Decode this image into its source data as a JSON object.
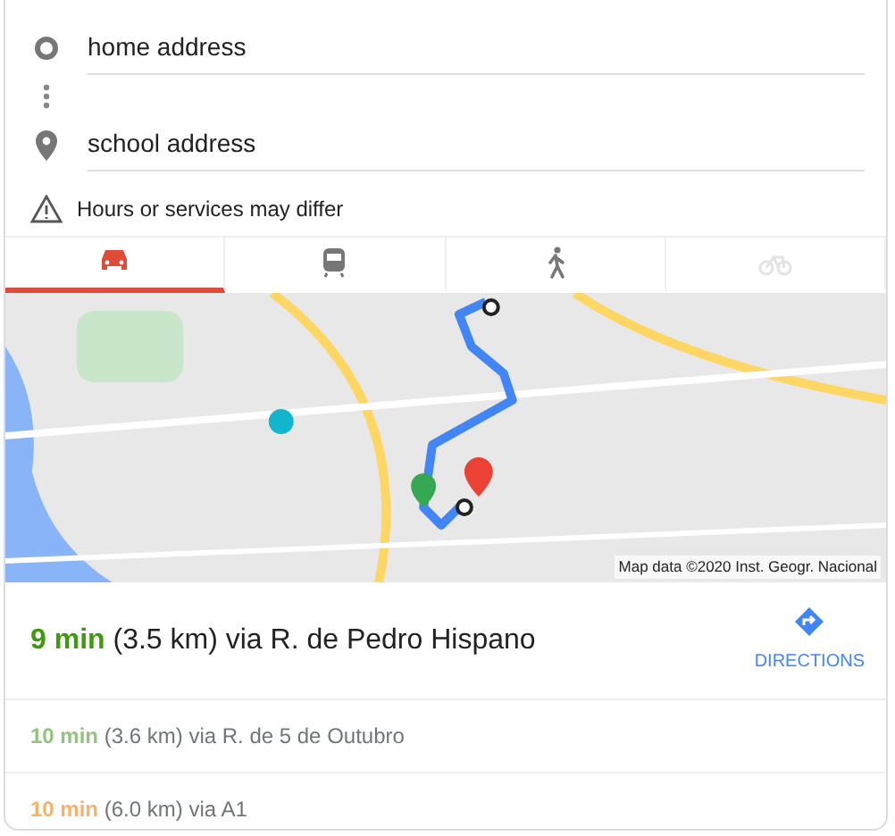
{
  "inputs": [
    {
      "kind": "origin",
      "value": "home address"
    },
    {
      "kind": "destination",
      "value": "school address"
    }
  ],
  "notice": "Hours or services may differ",
  "tabs": [
    {
      "kind": "car",
      "selected": true,
      "disabled": false
    },
    {
      "kind": "transit",
      "selected": false,
      "disabled": false
    },
    {
      "kind": "walk",
      "selected": false,
      "disabled": false
    },
    {
      "kind": "bike",
      "selected": false,
      "disabled": true
    }
  ],
  "map": {
    "attribution": "Map data ©2020 Inst. Geogr. Nacional"
  },
  "routes": [
    {
      "duration": "9 min",
      "detail": "(3.5 km) via R. de Pedro Hispano",
      "color": "#3f9a0f",
      "selected": true
    },
    {
      "duration": "10 min",
      "detail": "(3.6 km) via R. de 5 de Outubro",
      "color": "#93c47d",
      "selected": false
    },
    {
      "duration": "10 min",
      "detail": "(6.0 km) via A1",
      "color": "#f6b26b",
      "selected": false
    }
  ],
  "directions_button": "DIRECTIONS"
}
